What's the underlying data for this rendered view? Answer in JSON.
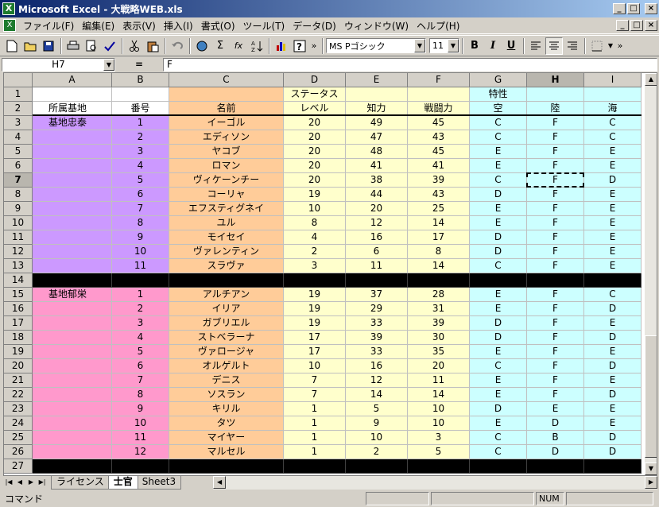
{
  "window": {
    "title": "Microsoft Excel - 大戦略WEB.xls",
    "app_icon": "X",
    "minimize": "_",
    "maximize": "□",
    "close": "×"
  },
  "menu": {
    "items": [
      "ファイル(F)",
      "編集(E)",
      "表示(V)",
      "挿入(I)",
      "書式(O)",
      "ツール(T)",
      "データ(D)",
      "ウィンドウ(W)",
      "ヘルプ(H)"
    ]
  },
  "toolbar": {
    "font_name": "MS Pゴシック",
    "font_size": "11",
    "bold": "B",
    "italic": "I",
    "underline": "U",
    "sum": "Σ",
    "fx": "fx",
    "more": "»"
  },
  "formula": {
    "name_box": "H7",
    "equals": "=",
    "value": "F"
  },
  "columns": [
    {
      "id": "A",
      "active": false
    },
    {
      "id": "B",
      "active": false
    },
    {
      "id": "C",
      "active": false
    },
    {
      "id": "D",
      "active": false
    },
    {
      "id": "E",
      "active": false
    },
    {
      "id": "F",
      "active": false
    },
    {
      "id": "G",
      "active": false
    },
    {
      "id": "H",
      "active": true
    },
    {
      "id": "I",
      "active": false
    }
  ],
  "rows": [
    {
      "n": "1",
      "type": "header1",
      "cells": [
        "",
        "",
        "",
        "ステータス",
        "",
        "",
        "特性",
        "",
        ""
      ]
    },
    {
      "n": "2",
      "type": "header2",
      "cells": [
        "所属基地",
        "番号",
        "名前",
        "レベル",
        "知力",
        "戦闘力",
        "空",
        "陸",
        "海"
      ]
    },
    {
      "n": "3",
      "type": "g1",
      "cells": [
        "基地忠泰",
        "1",
        "イーゴル",
        "20",
        "49",
        "45",
        "C",
        "F",
        "C"
      ]
    },
    {
      "n": "4",
      "type": "g1",
      "cells": [
        "",
        "2",
        "エディソン",
        "20",
        "47",
        "43",
        "C",
        "F",
        "C"
      ]
    },
    {
      "n": "5",
      "type": "g1",
      "cells": [
        "",
        "3",
        "ヤコブ",
        "20",
        "48",
        "45",
        "E",
        "F",
        "E"
      ]
    },
    {
      "n": "6",
      "type": "g1",
      "cells": [
        "",
        "4",
        "ロマン",
        "20",
        "41",
        "41",
        "E",
        "F",
        "E"
      ]
    },
    {
      "n": "7",
      "type": "g1",
      "cells": [
        "",
        "5",
        "ヴィケーンチー",
        "20",
        "38",
        "39",
        "C",
        "F",
        "D"
      ]
    },
    {
      "n": "8",
      "type": "g1",
      "cells": [
        "",
        "6",
        "コーリャ",
        "19",
        "44",
        "43",
        "D",
        "F",
        "E"
      ]
    },
    {
      "n": "9",
      "type": "g1",
      "cells": [
        "",
        "7",
        "エフスティグネイ",
        "10",
        "20",
        "25",
        "E",
        "F",
        "E"
      ]
    },
    {
      "n": "10",
      "type": "g1",
      "cells": [
        "",
        "8",
        "ユル",
        "8",
        "12",
        "14",
        "E",
        "F",
        "E"
      ]
    },
    {
      "n": "11",
      "type": "g1",
      "cells": [
        "",
        "9",
        "モイセイ",
        "4",
        "16",
        "17",
        "D",
        "F",
        "E"
      ]
    },
    {
      "n": "12",
      "type": "g1",
      "cells": [
        "",
        "10",
        "ヴァレンティン",
        "2",
        "6",
        "8",
        "D",
        "F",
        "E"
      ]
    },
    {
      "n": "13",
      "type": "g1",
      "cells": [
        "",
        "11",
        "スラヴァ",
        "3",
        "11",
        "14",
        "C",
        "F",
        "E"
      ]
    },
    {
      "n": "14",
      "type": "black",
      "cells": [
        "",
        "",
        "",
        "",
        "",
        "",
        "",
        "",
        ""
      ]
    },
    {
      "n": "15",
      "type": "g2",
      "cells": [
        "基地郁栄",
        "1",
        "アルチアン",
        "19",
        "37",
        "28",
        "E",
        "F",
        "C"
      ]
    },
    {
      "n": "16",
      "type": "g2",
      "cells": [
        "",
        "2",
        "イリア",
        "19",
        "29",
        "31",
        "E",
        "F",
        "D"
      ]
    },
    {
      "n": "17",
      "type": "g2",
      "cells": [
        "",
        "3",
        "ガブリエル",
        "19",
        "33",
        "39",
        "D",
        "F",
        "E"
      ]
    },
    {
      "n": "18",
      "type": "g2",
      "cells": [
        "",
        "4",
        "ストベラーナ",
        "17",
        "39",
        "30",
        "D",
        "F",
        "D"
      ]
    },
    {
      "n": "19",
      "type": "g2",
      "cells": [
        "",
        "5",
        "ヴァロージャ",
        "17",
        "33",
        "35",
        "E",
        "F",
        "E"
      ]
    },
    {
      "n": "20",
      "type": "g2",
      "cells": [
        "",
        "6",
        "オルゲルト",
        "10",
        "16",
        "20",
        "C",
        "F",
        "D"
      ]
    },
    {
      "n": "21",
      "type": "g2",
      "cells": [
        "",
        "7",
        "デニス",
        "7",
        "12",
        "11",
        "E",
        "F",
        "E"
      ]
    },
    {
      "n": "22",
      "type": "g2",
      "cells": [
        "",
        "8",
        "ソスラン",
        "7",
        "14",
        "14",
        "E",
        "F",
        "D"
      ]
    },
    {
      "n": "23",
      "type": "g2",
      "cells": [
        "",
        "9",
        "キリル",
        "1",
        "5",
        "10",
        "D",
        "E",
        "E"
      ]
    },
    {
      "n": "24",
      "type": "g2",
      "cells": [
        "",
        "10",
        "タツ",
        "1",
        "9",
        "10",
        "E",
        "D",
        "E"
      ]
    },
    {
      "n": "25",
      "type": "g2",
      "cells": [
        "",
        "11",
        "マイヤー",
        "1",
        "10",
        "3",
        "C",
        "B",
        "D"
      ]
    },
    {
      "n": "26",
      "type": "g2",
      "cells": [
        "",
        "12",
        "マルセル",
        "1",
        "2",
        "5",
        "C",
        "D",
        "D"
      ]
    },
    {
      "n": "27",
      "type": "black",
      "cells": [
        "",
        "",
        "",
        "",
        "",
        "",
        "",
        "",
        ""
      ]
    }
  ],
  "selected_cell": "H7",
  "colors": {
    "group1_base": "#cc99ff",
    "group2_base": "#ff99cc",
    "name_col": "#ffcc99",
    "stats_col": "#ffffcc",
    "traits_col": "#ccffff"
  },
  "tabs": [
    {
      "label": "ライセンス",
      "active": false
    },
    {
      "label": "士官",
      "active": true
    },
    {
      "label": "Sheet3",
      "active": false
    }
  ],
  "status": {
    "mode": "コマンド",
    "num": "NUM"
  }
}
